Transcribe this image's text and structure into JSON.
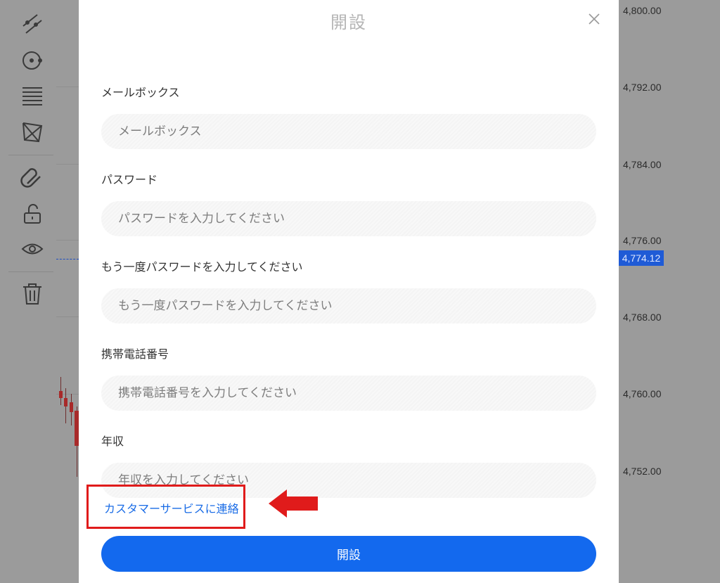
{
  "modal": {
    "title": "開設",
    "fields": [
      {
        "label": "メールボックス",
        "placeholder": "メールボックス"
      },
      {
        "label": "パスワード",
        "placeholder": "パスワードを入力してください"
      },
      {
        "label": "もう一度パスワードを入力してください",
        "placeholder": "もう一度パスワードを入力してください"
      },
      {
        "label": "携帯電話番号",
        "placeholder": "携帯電話番号を入力してください"
      },
      {
        "label": "年収",
        "placeholder": "年収を入力してください"
      }
    ],
    "customer_service_link": "カスタマーサービスに連絡",
    "submit_label": "開設"
  },
  "price_axis": {
    "labels": [
      "4,800.00",
      "4,792.00",
      "4,784.00",
      "4,776.00",
      "4,768.00",
      "4,760.00",
      "4,752.00"
    ],
    "current_price": "4,774.12"
  },
  "toolbar": {
    "icons": [
      "trend-line-icon",
      "circle-target-icon",
      "fib-levels-icon",
      "pattern-icon",
      "magnet-icon",
      "unlock-icon",
      "eye-icon",
      "trash-icon"
    ]
  },
  "colors": {
    "accent": "#1369ee",
    "link": "#1a6ce6",
    "highlight": "#e01b1b",
    "current_price_bg": "#1f5bd6"
  }
}
